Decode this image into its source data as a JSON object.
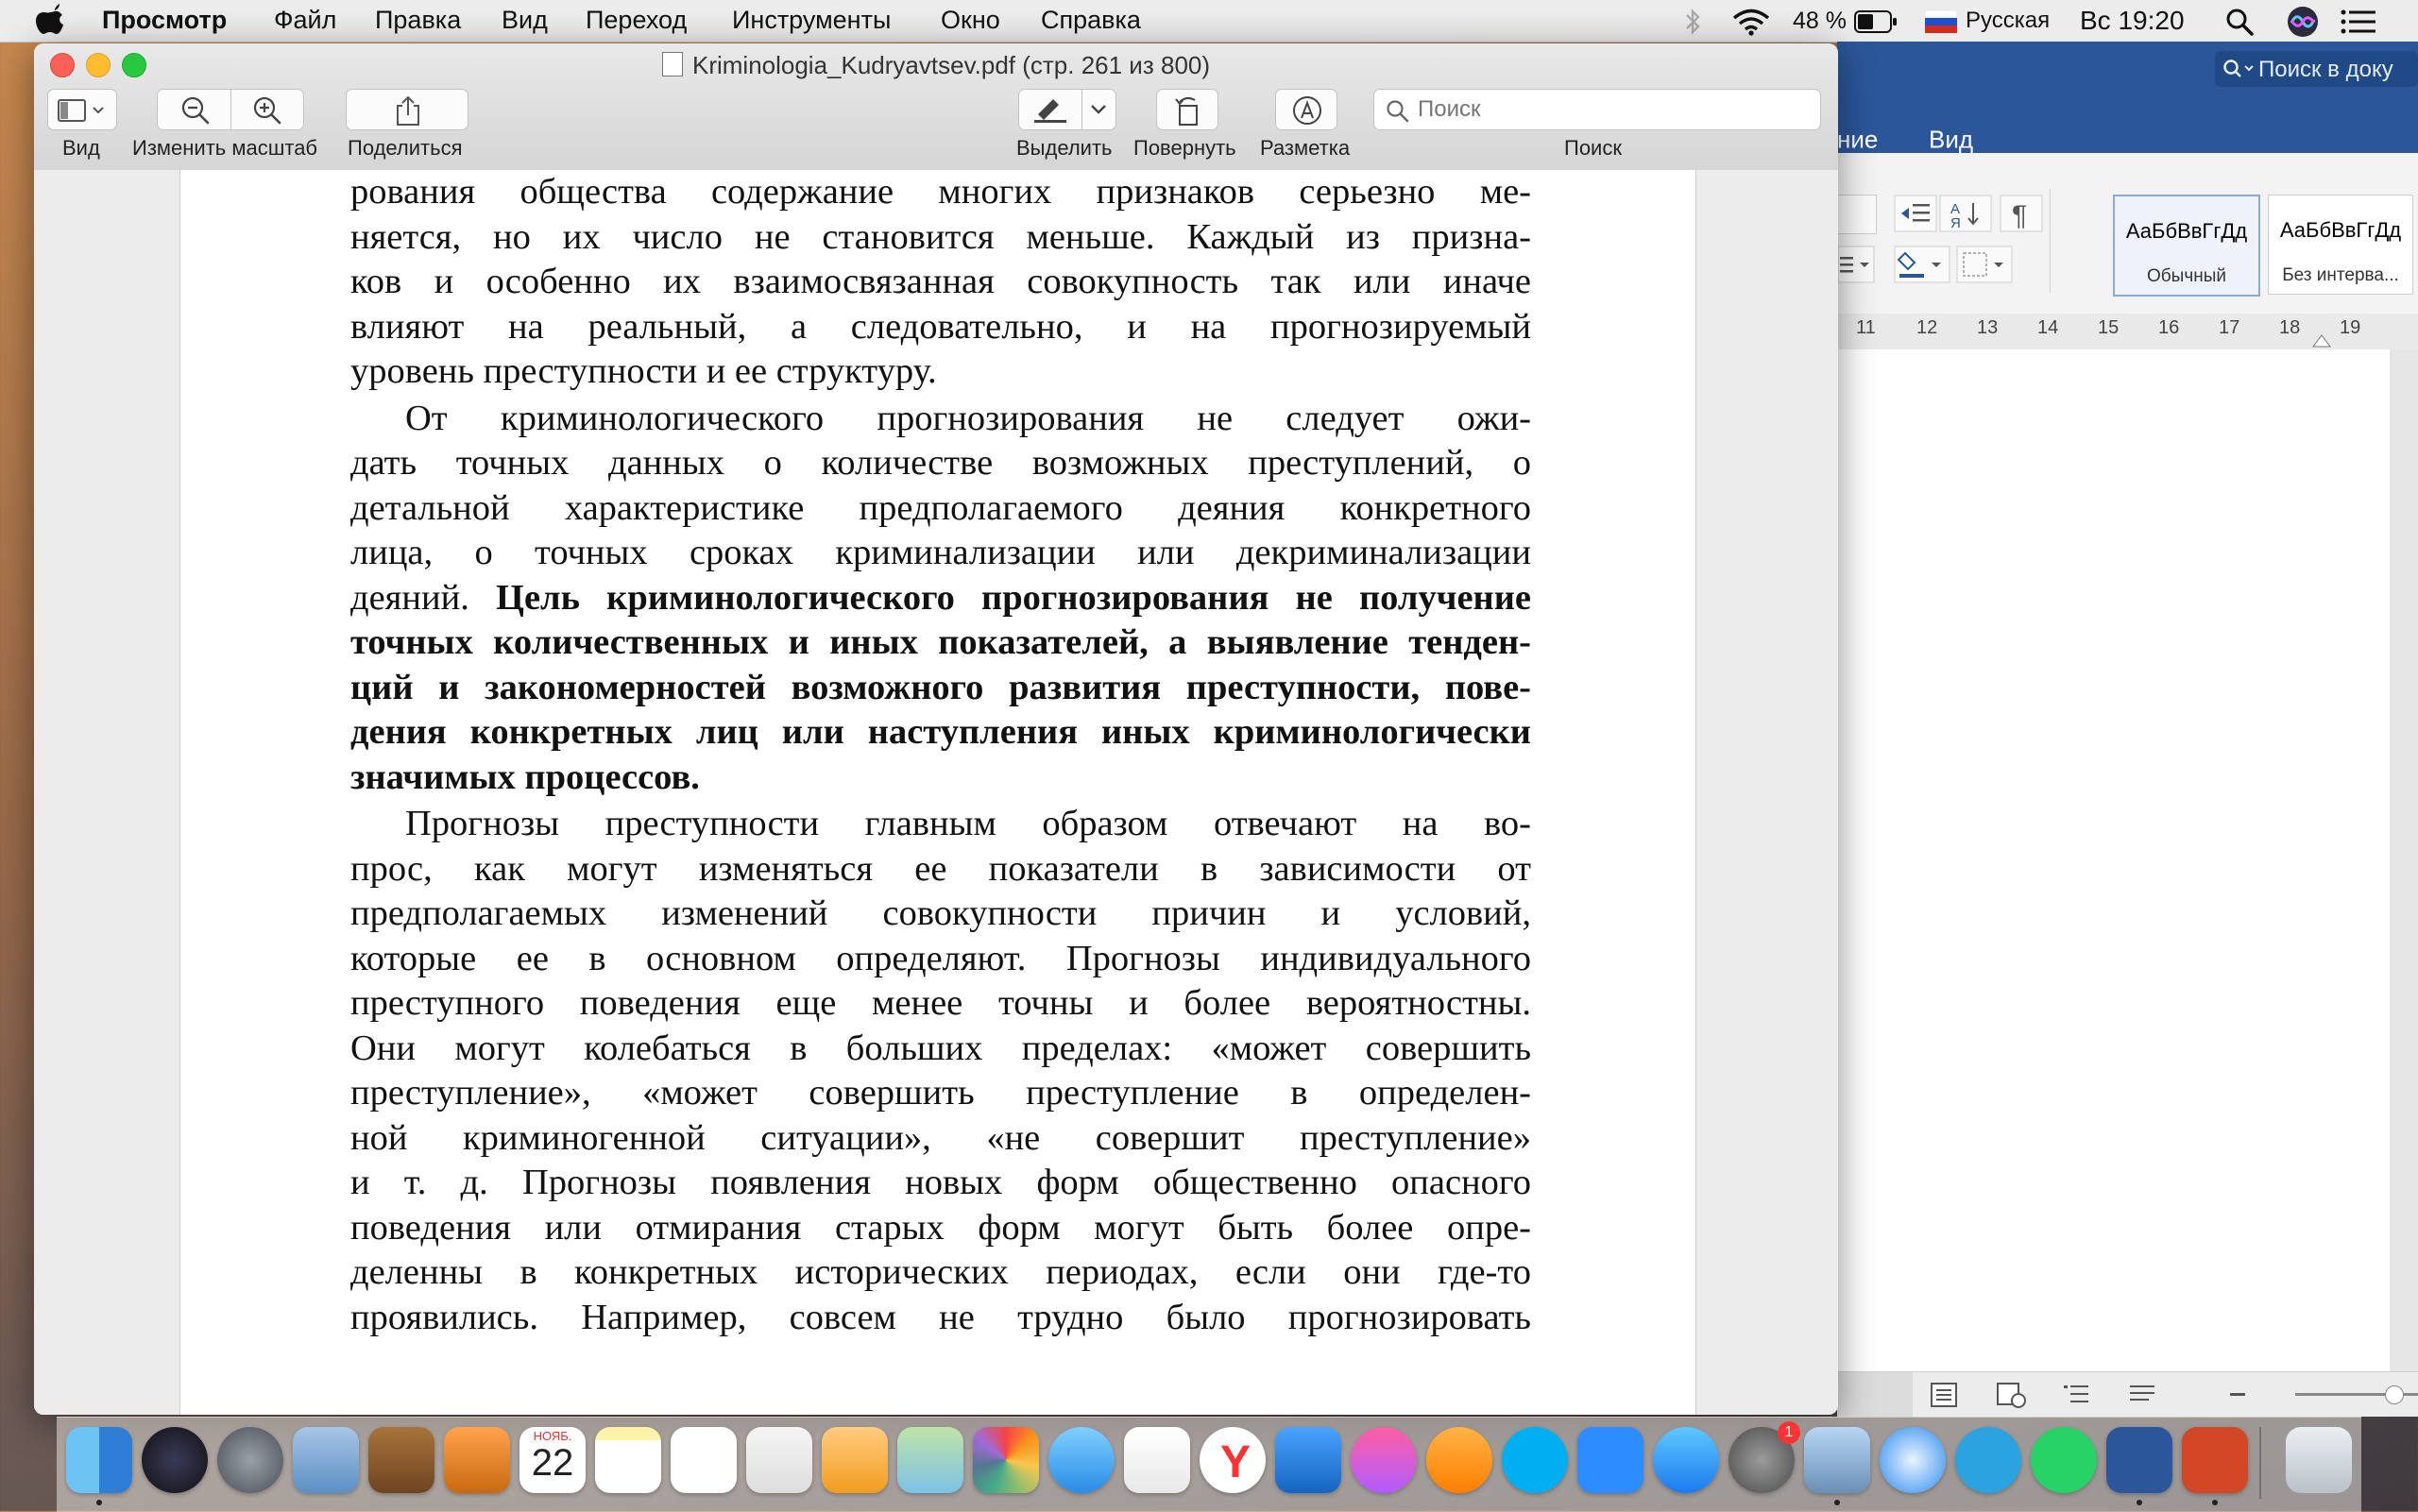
{
  "menubar": {
    "app_name": "Просмотр",
    "items": [
      "Файл",
      "Правка",
      "Вид",
      "Переход",
      "Инструменты",
      "Окно",
      "Справка"
    ],
    "battery": "48 %",
    "input_source": "Русская",
    "clock": "Вс 19:20"
  },
  "preview": {
    "title": "Kriminologia_Kudryavtsev.pdf (стр. 261 из 800)",
    "toolbar": {
      "view_label": "Вид",
      "zoom_label": "Изменить масштаб",
      "share_label": "Поделиться",
      "highlight_label": "Выделить",
      "rotate_label": "Повернуть",
      "markup_label": "Разметка",
      "search_label": "Поиск",
      "search_placeholder": "Поиск"
    },
    "page_lines": {
      "p1": [
        "рования общества содержание многих признаков серьезно ме-",
        "няется, но их число не становится меньше. Каждый из призна-",
        "ков и особенно их взаимосвязанная совокупность так или иначе",
        "влияют на реальный, а следовательно, и на прогнозируемый",
        "уровень преступности и ее структуру."
      ],
      "p2_normal": [
        "От криминологического прогнозирования не следует ожи-",
        "дать точных данных о количестве возможных преступлений, о",
        "детальной характеристике предполагаемого деяния конкретного",
        "лица, о точных сроках криминализации или декриминализации"
      ],
      "p2_mixed_normal": "деяний. ",
      "p2_mixed_bold": "Цель криминологического прогнозирования не получение",
      "p2_bold": [
        "точных количественных и иных показателей, а выявление тенден-",
        "ций и закономерностей возможного развития преступности, пове-",
        "дения конкретных лиц или наступления иных криминологически",
        "значимых процессов."
      ],
      "p3": [
        "Прогнозы преступности главным образом отвечают на во-",
        "прос, как могут изменяться ее показатели в зависимости от",
        "предполагаемых изменений совокупности причин и условий,",
        "которые ее в основном определяют. Прогнозы индивидуального",
        "преступного поведения еще менее точны и более вероятностны.",
        "Они могут колебаться в больших пределах: «может совершить",
        "преступление», «может совершить преступление в определен-",
        "ной криминогенной ситуации», «не совершит преступление»",
        "и т. д. Прогнозы появления новых форм общественно опасного",
        "поведения или отмирания старых форм могут быть более опре-",
        "деленны в конкретных исторических периодах, если они где-то",
        "проявились. Например, совсем не трудно было прогнозировать"
      ]
    }
  },
  "word": {
    "search_placeholder": "Поиск в доку",
    "tab_partial": "ние",
    "tab_view": "Вид",
    "style1_sample": "АаБбВвГгДд",
    "style1_label": "Обычный",
    "style2_sample": "АаБбВвГгДд",
    "style2_label": "Без интерва...",
    "ruler_numbers": [
      "11",
      "12",
      "13",
      "14",
      "15",
      "16",
      "17",
      "18",
      "19"
    ]
  },
  "dock": {
    "calendar_month": "НОЯБ.",
    "calendar_day": "22",
    "settings_badge": "1"
  },
  "colors": {
    "word_blue": "#2b579a",
    "close": "#fe5f57",
    "minimize": "#febc2e",
    "zoom": "#28c840"
  }
}
